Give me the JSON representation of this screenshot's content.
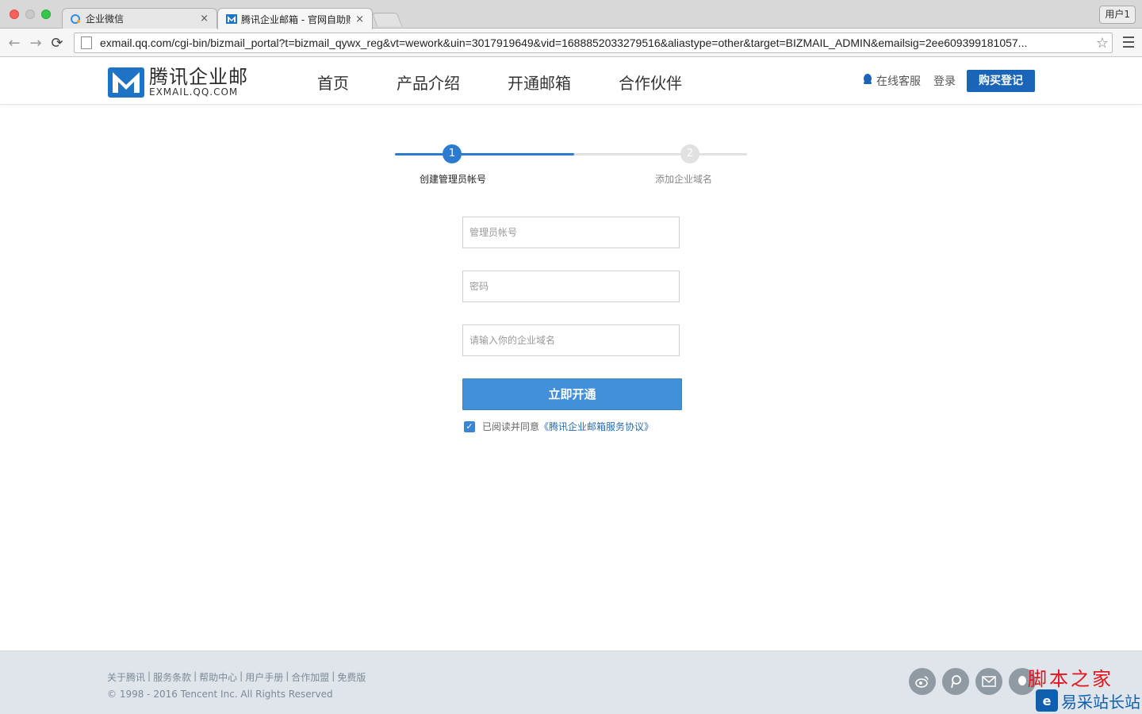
{
  "browser": {
    "tabs": [
      {
        "title": "企业微信"
      },
      {
        "title": "腾讯企业邮箱 - 官网自助购买"
      }
    ],
    "tab_close": "×",
    "profile": "用户1",
    "url": "exmail.qq.com/cgi-bin/bizmail_portal?t=bizmail_qywx_reg&vt=wework&uin=3017919649&vid=1688852033279516&aliastype=other&target=BIZMAIL_ADMIN&emailsig=2ee609399181057...",
    "icons": {
      "back": "←",
      "forward": "→",
      "reload": "⟳",
      "star": "☆"
    }
  },
  "header": {
    "logo_cn": "腾讯企业邮",
    "logo_en": "EXMAIL.QQ.COM",
    "nav": [
      "首页",
      "产品介绍",
      "开通邮箱",
      "合作伙伴"
    ],
    "support": "在线客服",
    "login": "登录",
    "buy": "购买登记"
  },
  "steps": {
    "progress": 0.51,
    "items": [
      {
        "number": "1",
        "label": "创建管理员帐号",
        "state": "active"
      },
      {
        "number": "2",
        "label": "添加企业域名",
        "state": "pending"
      }
    ]
  },
  "form": {
    "admin_placeholder": "管理员帐号",
    "password_placeholder": "密码",
    "domain_placeholder": "请输入你的企业域名",
    "submit": "立即开通",
    "agree_checked": true,
    "agree_prefix": "已阅读并同意",
    "agree_link": "《腾讯企业邮箱服务协议》"
  },
  "footer": {
    "links": [
      "关于腾讯",
      "服务条款",
      "帮助中心",
      "用户手册",
      "合作加盟",
      "免费版"
    ],
    "separator": "|",
    "copyright": "© 1998 - 2016 Tencent Inc. All Rights Reserved",
    "social_icons": [
      "weibo-icon",
      "pengyou-icon",
      "mail-icon",
      "qq-icon"
    ]
  },
  "watermark": {
    "top": "脚本之家",
    "bottom": "易采站长站"
  },
  "colors": {
    "brand_blue": "#1b65b8",
    "step_active": "#2d7bd0",
    "submit": "#4290d9",
    "footer_bg": "#dfe5ea"
  }
}
